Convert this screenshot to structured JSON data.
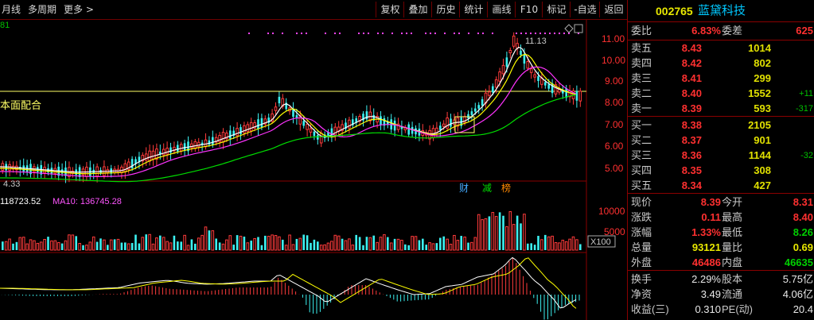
{
  "toolbar": {
    "period_month": "月线",
    "period_multi": "多周期",
    "more": "更多 >",
    "buttons": [
      "复权",
      "叠加",
      "历史",
      "统计",
      "画线",
      "F10",
      "标记",
      "-自选",
      "返回"
    ]
  },
  "chart": {
    "watermark_text": "本面配合",
    "top_left_value": "81",
    "high_label": "11.13",
    "low_label": "4.33",
    "badges": {
      "cai": "财",
      "jian": "减",
      "bang": "榜"
    },
    "price_axis": [
      "11.00",
      "10.00",
      "9.00",
      "8.00",
      "7.00",
      "6.00",
      "5.00"
    ],
    "volume_label_ma5": "118723.52",
    "volume_label_ma10": "MA10: 136745.28",
    "volume_axis": [
      "10000",
      "5000"
    ],
    "volume_unit": "X100",
    "colors": {
      "up": "#ff3b3b",
      "down": "#3cf0f0",
      "ma5": "#ffffff",
      "ma10": "#ffff00",
      "ma20": "#ff33ff",
      "ma60": "#00dd00",
      "hline": "#ffff66"
    }
  },
  "quote": {
    "code": "002765",
    "name": "蓝黛科技",
    "weibi_label": "委比",
    "weibi": "6.83%",
    "weicha_label": "委差",
    "weicha": "625",
    "asks": [
      {
        "label": "卖五",
        "price": "8.43",
        "vol": "1014",
        "chg": ""
      },
      {
        "label": "卖四",
        "price": "8.42",
        "vol": "802",
        "chg": ""
      },
      {
        "label": "卖三",
        "price": "8.41",
        "vol": "299",
        "chg": ""
      },
      {
        "label": "卖二",
        "price": "8.40",
        "vol": "1552",
        "chg": "+11"
      },
      {
        "label": "卖一",
        "price": "8.39",
        "vol": "593",
        "chg": "-317"
      }
    ],
    "bids": [
      {
        "label": "买一",
        "price": "8.38",
        "vol": "2105",
        "chg": ""
      },
      {
        "label": "买二",
        "price": "8.37",
        "vol": "901",
        "chg": ""
      },
      {
        "label": "买三",
        "price": "8.36",
        "vol": "1144",
        "chg": "-32"
      },
      {
        "label": "买四",
        "price": "8.35",
        "vol": "308",
        "chg": ""
      },
      {
        "label": "买五",
        "price": "8.34",
        "vol": "427",
        "chg": ""
      }
    ],
    "stats": [
      {
        "l1": "现价",
        "v1": "8.39",
        "c1": "red",
        "l2": "今开",
        "v2": "8.31",
        "c2": "red"
      },
      {
        "l1": "涨跌",
        "v1": "0.11",
        "c1": "red",
        "l2": "最高",
        "v2": "8.40",
        "c2": "red"
      },
      {
        "l1": "涨幅",
        "v1": "1.33%",
        "c1": "red",
        "l2": "最低",
        "v2": "8.26",
        "c2": "grn"
      },
      {
        "l1": "总量",
        "v1": "93121",
        "c1": "yel",
        "l2": "量比",
        "v2": "0.69",
        "c2": "yel"
      },
      {
        "l1": "外盘",
        "v1": "46486",
        "c1": "red",
        "l2": "内盘",
        "v2": "46635",
        "c2": "grn"
      }
    ],
    "fund": [
      {
        "l1": "换手",
        "v1": "2.29%",
        "l2": "股本",
        "v2": "5.75亿"
      },
      {
        "l1": "净资",
        "v1": "3.49",
        "l2": "流通",
        "v2": "4.06亿"
      },
      {
        "l1": "收益(三)",
        "v1": "0.310",
        "l2": "PE(动)",
        "v2": "20.4"
      }
    ]
  }
}
